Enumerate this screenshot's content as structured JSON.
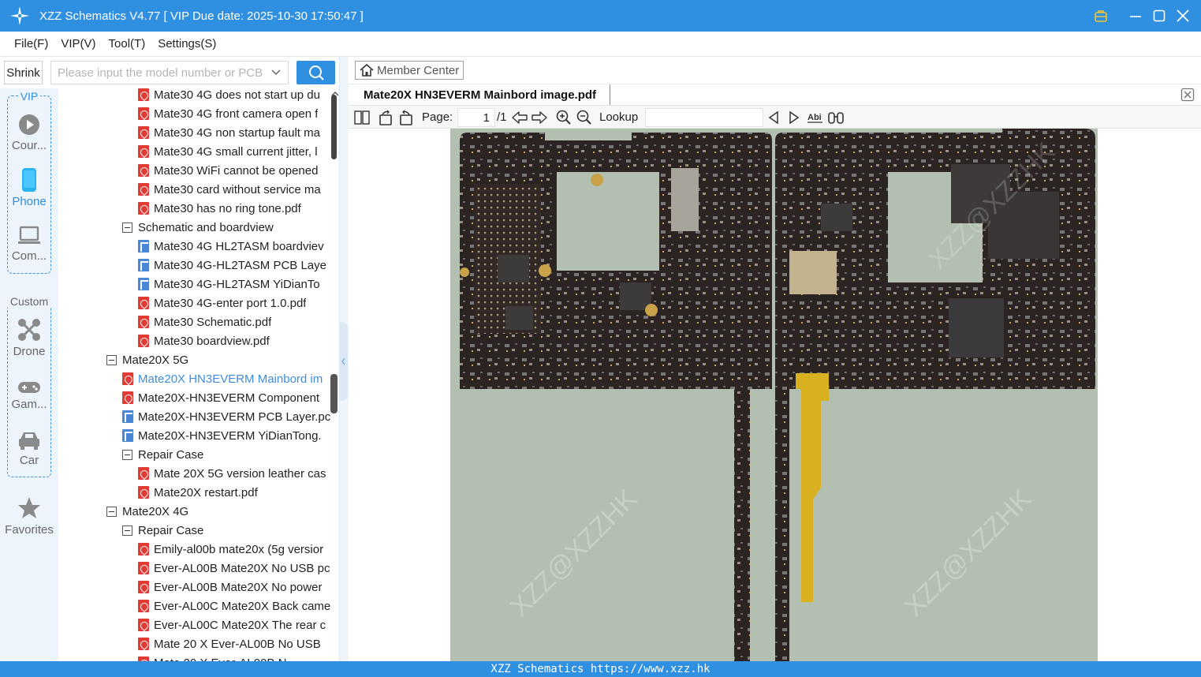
{
  "app": {
    "title": "XZZ Schematics V4.77 [ VIP Due date: 2025-10-30 17:50:47 ]"
  },
  "menu": [
    "File(F)",
    "VIP(V)",
    "Tool(T)",
    "Settings(S)"
  ],
  "search": {
    "shrink_label": "Shrink",
    "placeholder": "Please input the model number or PCB"
  },
  "sidebar": {
    "vip_label": "VIP",
    "custom_label": "Custom",
    "items": [
      {
        "label": "Cour...",
        "icon": "play-icon"
      },
      {
        "label": "Phone",
        "icon": "phone-icon",
        "active": true
      },
      {
        "label": "Com...",
        "icon": "laptop-icon"
      },
      {
        "label": "Drone",
        "icon": "drone-icon"
      },
      {
        "label": "Gam...",
        "icon": "gamepad-icon"
      },
      {
        "label": "Car",
        "icon": "car-icon"
      },
      {
        "label": "Favorites",
        "icon": "star-icon"
      }
    ]
  },
  "tree": [
    {
      "type": "pdf",
      "level": 2,
      "label": "Mate30 4G does not start up du"
    },
    {
      "type": "pdf",
      "level": 2,
      "label": "Mate30 4G front camera open f"
    },
    {
      "type": "pdf",
      "level": 2,
      "label": "Mate30 4G non startup fault ma"
    },
    {
      "type": "pdf",
      "level": 2,
      "label": "Mate30 4G small current jitter, l"
    },
    {
      "type": "pdf",
      "level": 2,
      "label": "Mate30 WiFi cannot be opened"
    },
    {
      "type": "pdf",
      "level": 2,
      "label": "Mate30 card without service ma"
    },
    {
      "type": "pdf",
      "level": 2,
      "label": "Mate30 has no ring tone.pdf"
    },
    {
      "type": "folder",
      "level": 1,
      "label": "Schematic and boardview"
    },
    {
      "type": "bv",
      "level": 2,
      "label": "Mate30 4G HL2TASM boardviev"
    },
    {
      "type": "bv",
      "level": 2,
      "label": "Mate30 4G-HL2TASM PCB Laye"
    },
    {
      "type": "bv",
      "level": 2,
      "label": "Mate30 4G-HL2TASM YiDianTo"
    },
    {
      "type": "pdf",
      "level": 2,
      "label": "Mate30 4G-enter port 1.0.pdf"
    },
    {
      "type": "pdf",
      "level": 2,
      "label": "Mate30 Schematic.pdf"
    },
    {
      "type": "pdf",
      "level": 2,
      "label": "Mate30 boardview.pdf"
    },
    {
      "type": "folder",
      "level": 0,
      "label": "Mate20X 5G"
    },
    {
      "type": "pdf",
      "level": 1,
      "label": "Mate20X HN3EVERM Mainbord im",
      "selected": true
    },
    {
      "type": "pdf",
      "level": 1,
      "label": "Mate20X-HN3EVERM Component"
    },
    {
      "type": "bv",
      "level": 1,
      "label": "Mate20X-HN3EVERM PCB Layer.pc"
    },
    {
      "type": "bv",
      "level": 1,
      "label": "Mate20X-HN3EVERM YiDianTong."
    },
    {
      "type": "folder",
      "level": 1,
      "label": "Repair Case"
    },
    {
      "type": "pdf",
      "level": 2,
      "label": "Mate 20X 5G version leather cas"
    },
    {
      "type": "pdf",
      "level": 2,
      "label": "Mate20X restart.pdf"
    },
    {
      "type": "folder",
      "level": 0,
      "label": "Mate20X 4G"
    },
    {
      "type": "folder",
      "level": 1,
      "label": "Repair Case"
    },
    {
      "type": "pdf",
      "level": 2,
      "label": "Emily-al00b mate20x (5g versior"
    },
    {
      "type": "pdf",
      "level": 2,
      "label": "Ever-AL00B Mate20X No USB pc"
    },
    {
      "type": "pdf",
      "level": 2,
      "label": "Ever-AL00B Mate20X No power"
    },
    {
      "type": "pdf",
      "level": 2,
      "label": "Ever-AL00C Mate20X Back came"
    },
    {
      "type": "pdf",
      "level": 2,
      "label": "Ever-AL00C Mate20X The rear c"
    },
    {
      "type": "pdf",
      "level": 2,
      "label": "Mate 20 X  Ever-AL00B No USB"
    },
    {
      "type": "pdf",
      "level": 2,
      "label": "Mate 20 X  Ever-AL00B N"
    }
  ],
  "viewer": {
    "member_center": "Member Center",
    "tab_title": "Mate20X HN3EVERM Mainbord image.pdf",
    "page_label": "Page:",
    "page_current": "1",
    "page_total": "/1",
    "lookup_label": "Lookup",
    "watermark": "XZZ@XZZHK"
  },
  "status": {
    "text": "XZZ Schematics https://www.xzz.hk"
  },
  "colors": {
    "accent": "#2f8fe0",
    "selected_text": "#3d8ee0",
    "pdf_icon": "#e03b35",
    "boardview_icon": "#4a86d6",
    "pcb_background": "#b3c0b1",
    "pcb_board": "#2a2220"
  }
}
